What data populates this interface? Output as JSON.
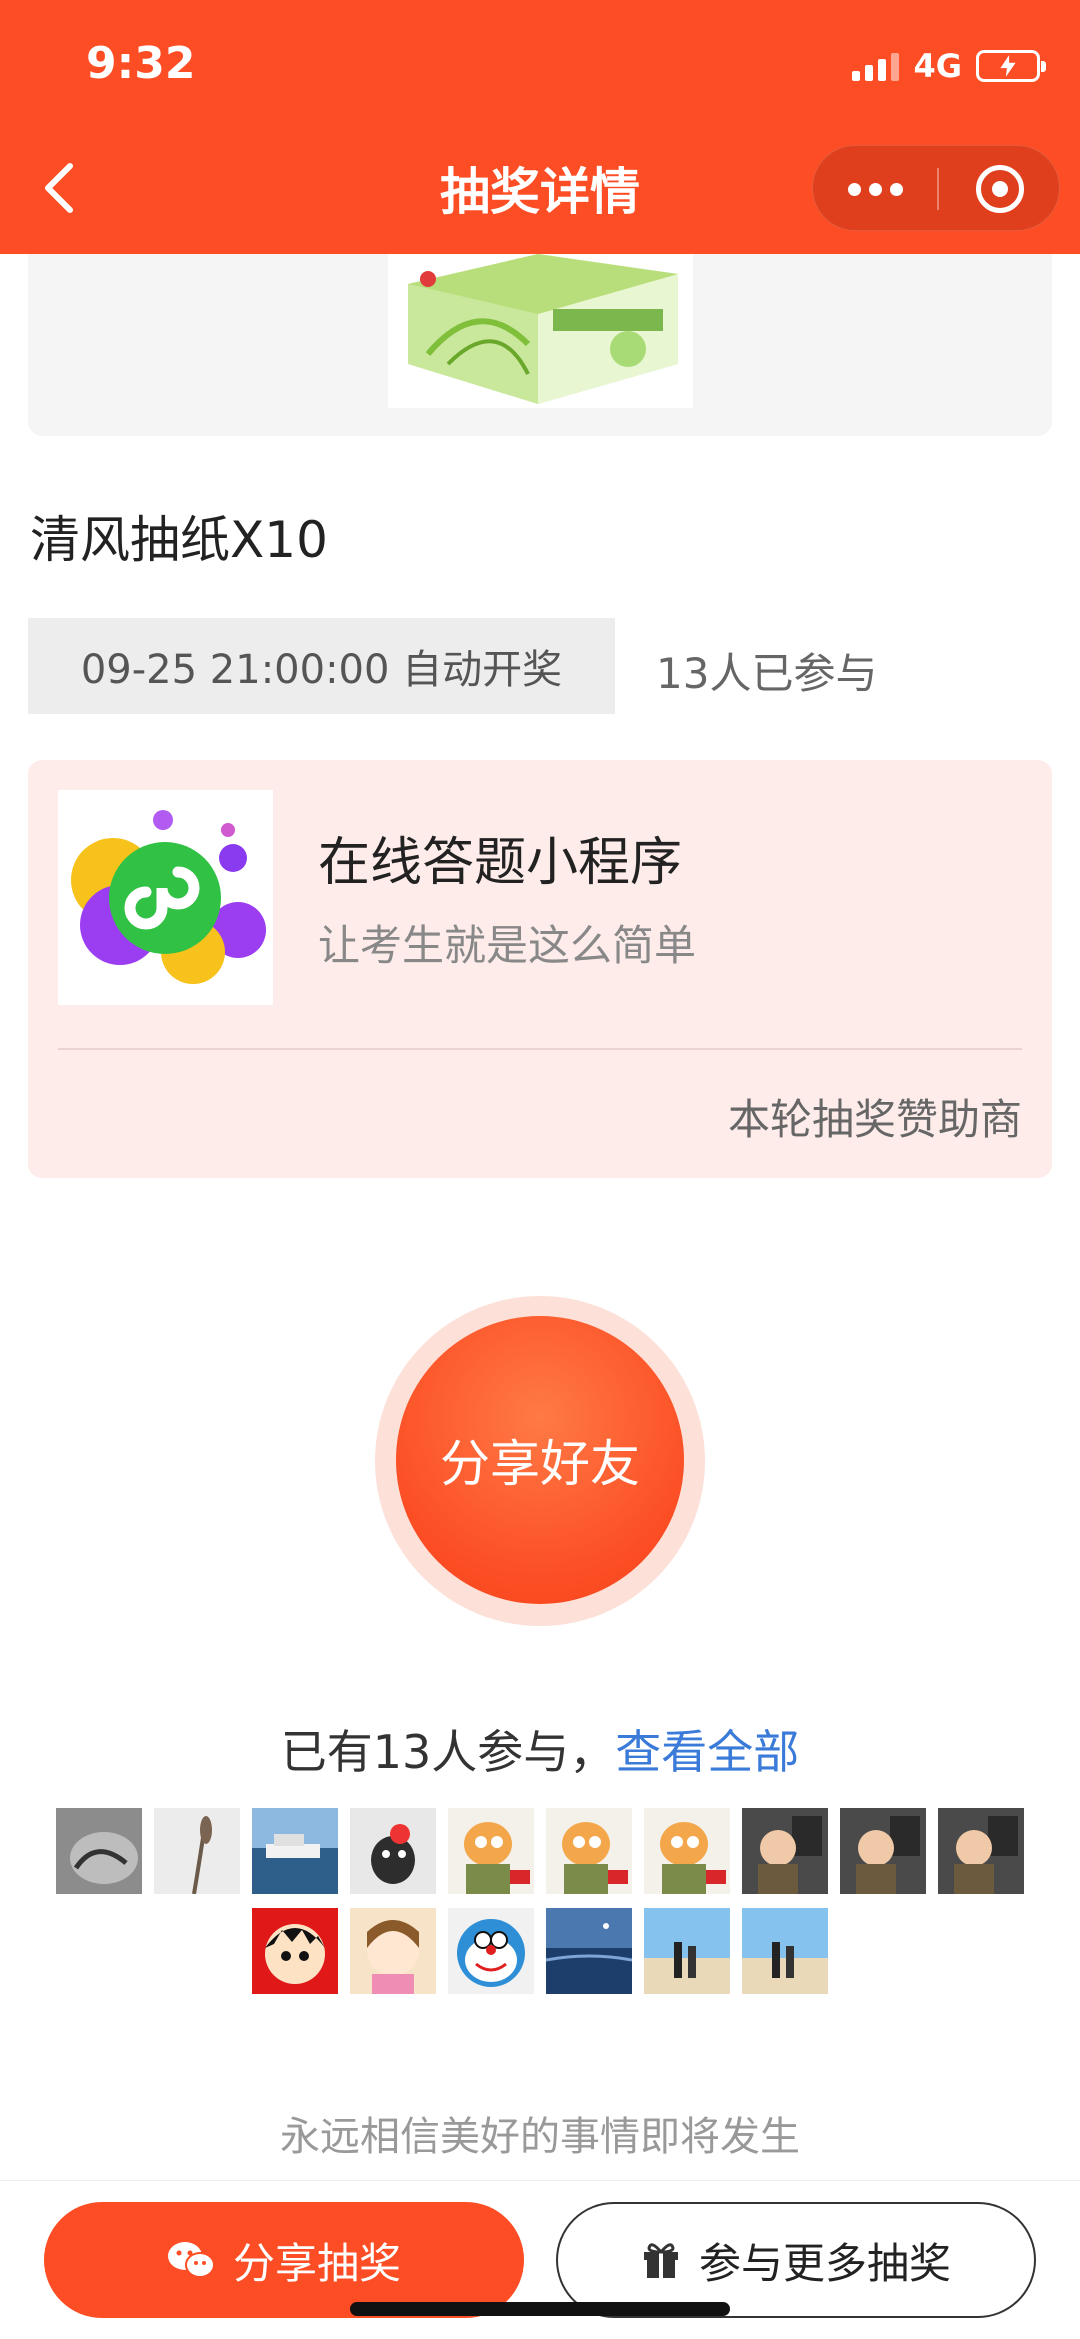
{
  "status_bar": {
    "time": "9:32",
    "network": "4G"
  },
  "nav": {
    "title": "抽奖详情"
  },
  "prize": {
    "name": "清风抽纸X10"
  },
  "draw": {
    "time_text": "09-25 21:00:00 自动开奖",
    "participants_text": "13人已参与"
  },
  "sponsor": {
    "name": "在线答题小程序",
    "slogan": "让考生就是这么简单",
    "label": "本轮抽奖赞助商"
  },
  "share_button": {
    "label": "分享好友"
  },
  "participants": {
    "prefix": "已有13人参与，",
    "view_all": "查看全部"
  },
  "footer": {
    "text": "永远相信美好的事情即将发生"
  },
  "bottom_bar": {
    "share_lottery": "分享抽奖",
    "more_lottery": "参与更多抽奖"
  },
  "colors": {
    "brand": "#fc4d24",
    "link": "#3a7ad8",
    "sponsor_bg": "#fdecea"
  }
}
